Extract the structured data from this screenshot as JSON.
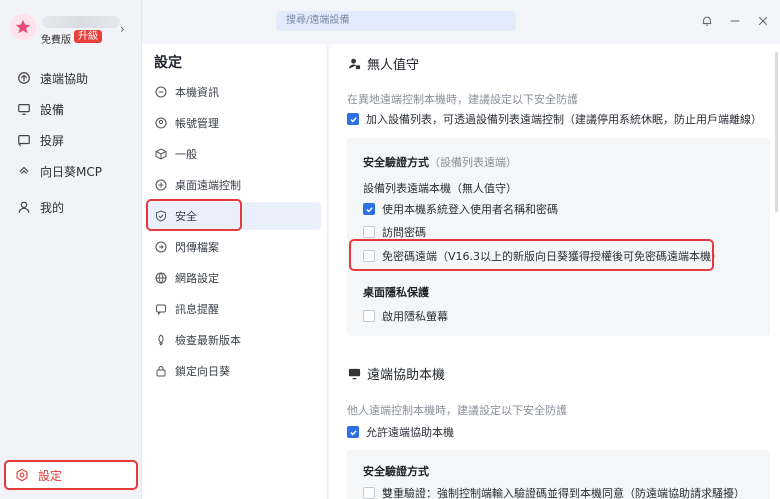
{
  "profile": {
    "plan": "免費版",
    "upgrade": "升級"
  },
  "sidebar": {
    "items": [
      {
        "label": "遠端協助",
        "icon": "remote-assist-icon"
      },
      {
        "label": "設備",
        "icon": "monitor-icon"
      },
      {
        "label": "投屏",
        "icon": "cast-icon"
      },
      {
        "label": "向日葵MCP",
        "icon": "mcp-icon"
      },
      {
        "label": "我的",
        "icon": "user-icon"
      }
    ],
    "settings": {
      "label": "設定",
      "icon": "gear-icon"
    }
  },
  "search": {
    "placeholder": "搜尋/遠端設備"
  },
  "settings_menu": {
    "title": "設定",
    "items": [
      {
        "label": "本機資訊",
        "icon": "info-icon"
      },
      {
        "label": "帳號管理",
        "icon": "account-icon"
      },
      {
        "label": "一般",
        "icon": "cube-icon"
      },
      {
        "label": "桌面遠端控制",
        "icon": "desktop-control-icon"
      },
      {
        "label": "安全",
        "icon": "shield-icon"
      },
      {
        "label": "閃傳檔案",
        "icon": "file-transfer-icon"
      },
      {
        "label": "網路設定",
        "icon": "globe-icon"
      },
      {
        "label": "訊息提醒",
        "icon": "message-icon"
      },
      {
        "label": "檢查最新版本",
        "icon": "update-icon"
      },
      {
        "label": "鎖定向日葵",
        "icon": "lock-icon"
      }
    ]
  },
  "unattended": {
    "title": "無人值守",
    "desc": "在異地遠端控制本機時，建議設定以下安全防護",
    "add_device_list": "加入設備列表，可透過設備列表遠端控制（建議停用系統休眠，防止用戶端離線）",
    "card": {
      "title": "安全驗證方式",
      "title_note": "（設備列表遠端）",
      "sub": "設備列表遠端本機（無人值守）",
      "opt_system_login": "使用本機系統登入使用者名稱和密碼",
      "opt_access_password": "訪問密碼",
      "opt_passwordless": "免密碼遠端（V16.3以上的新版向日葵獲得授權後可免密碼遠端本機）",
      "privacy_title": "桌面隱私保護",
      "privacy_screen": "啟用隱私螢幕"
    }
  },
  "assist": {
    "title": "遠端協助本機",
    "desc": "他人遠端控制本機時，建議設定以下安全防護",
    "allow": "允許遠端協助本機",
    "card": {
      "title": "安全驗證方式",
      "double_verify": "雙重驗證：強制控制端輸入驗證碼並得到本機同意（防遠端協助請求騷擾）"
    }
  },
  "colors": {
    "accent": "#2f6fe4",
    "highlight": "#e63a3a",
    "upgrade": "#e8413c"
  }
}
